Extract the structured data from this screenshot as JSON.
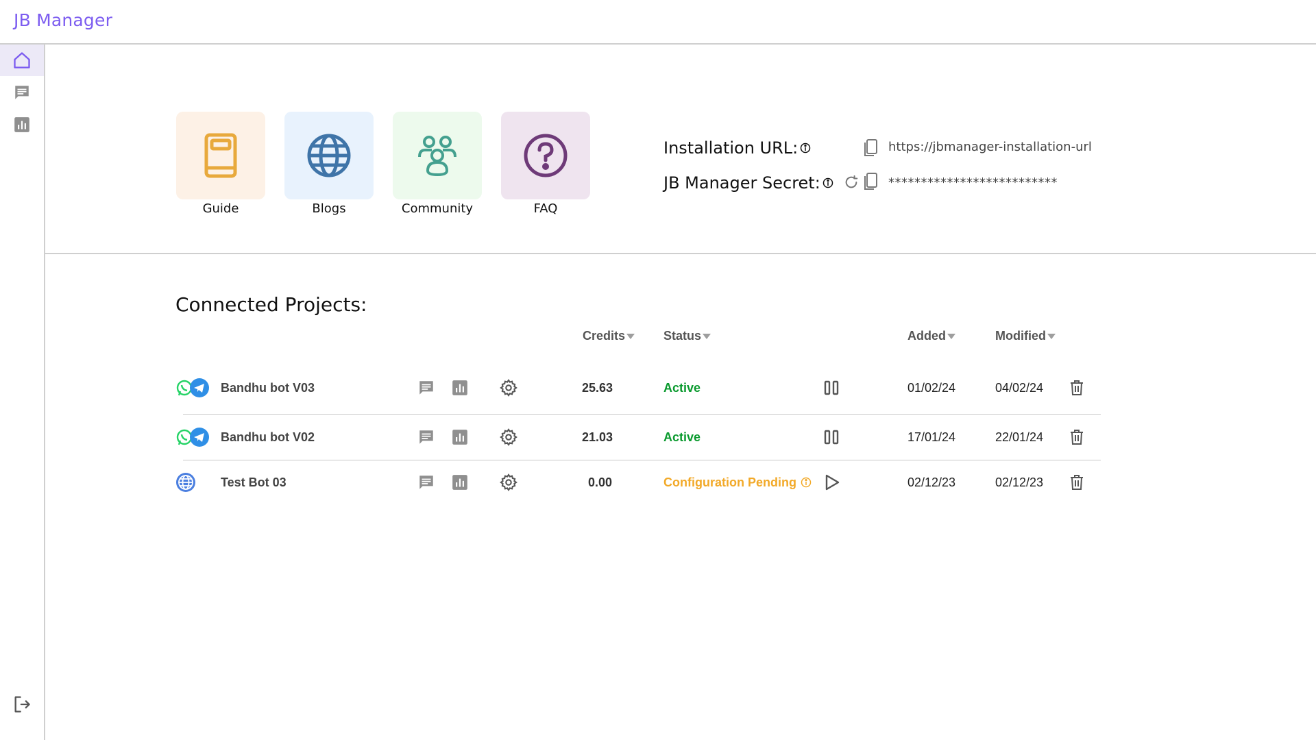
{
  "app": {
    "title": "JB Manager"
  },
  "sidebar": {
    "items": [
      {
        "name": "home",
        "icon": "home-icon",
        "active": true
      },
      {
        "name": "chat",
        "icon": "chat-icon",
        "active": false
      },
      {
        "name": "analytics",
        "icon": "chart-icon",
        "active": false
      }
    ],
    "logout_icon": "logout-icon"
  },
  "tiles": [
    {
      "label": "Guide",
      "icon": "book-icon",
      "bg": "#fdf1e6",
      "color": "#e8a93c"
    },
    {
      "label": "Blogs",
      "icon": "globe-icon",
      "bg": "#e8f2fd",
      "color": "#3f74a8"
    },
    {
      "label": "Community",
      "icon": "people-icon",
      "bg": "#edfaed",
      "color": "#44a08f"
    },
    {
      "label": "FAQ",
      "icon": "question-icon",
      "bg": "#efe4ef",
      "color": "#6e3a78"
    }
  ],
  "credentials": {
    "installation_url_label": "Installation URL:",
    "installation_url_value": "https://jbmanager-installation-url",
    "secret_label": "JB Manager Secret:",
    "secret_value": "**************************"
  },
  "projects": {
    "title": "Connected Projects:",
    "columns": {
      "credits": "Credits",
      "status": "Status",
      "added": "Added",
      "modified": "Modified"
    },
    "rows": [
      {
        "name": "Bandhu bot V03",
        "channels": [
          "whatsapp",
          "telegram"
        ],
        "credits": "25.63",
        "status": "Active",
        "status_type": "active",
        "action_icon": "pause-icon",
        "added": "01/02/24",
        "modified": "04/02/24"
      },
      {
        "name": "Bandhu bot V02",
        "channels": [
          "whatsapp",
          "telegram"
        ],
        "credits": "21.03",
        "status": "Active",
        "status_type": "active",
        "action_icon": "pause-icon",
        "added": "17/01/24",
        "modified": "22/01/24"
      },
      {
        "name": "Test Bot 03",
        "channels": [
          "web"
        ],
        "credits": "0.00",
        "status": "Configuration Pending",
        "status_type": "pending",
        "action_icon": "play-icon",
        "added": "02/12/23",
        "modified": "02/12/23"
      }
    ]
  },
  "colors": {
    "accent": "#7c5cf0",
    "active": "#0a9a2e",
    "pending": "#f2a928",
    "icon_gray": "#8a8a8a"
  }
}
